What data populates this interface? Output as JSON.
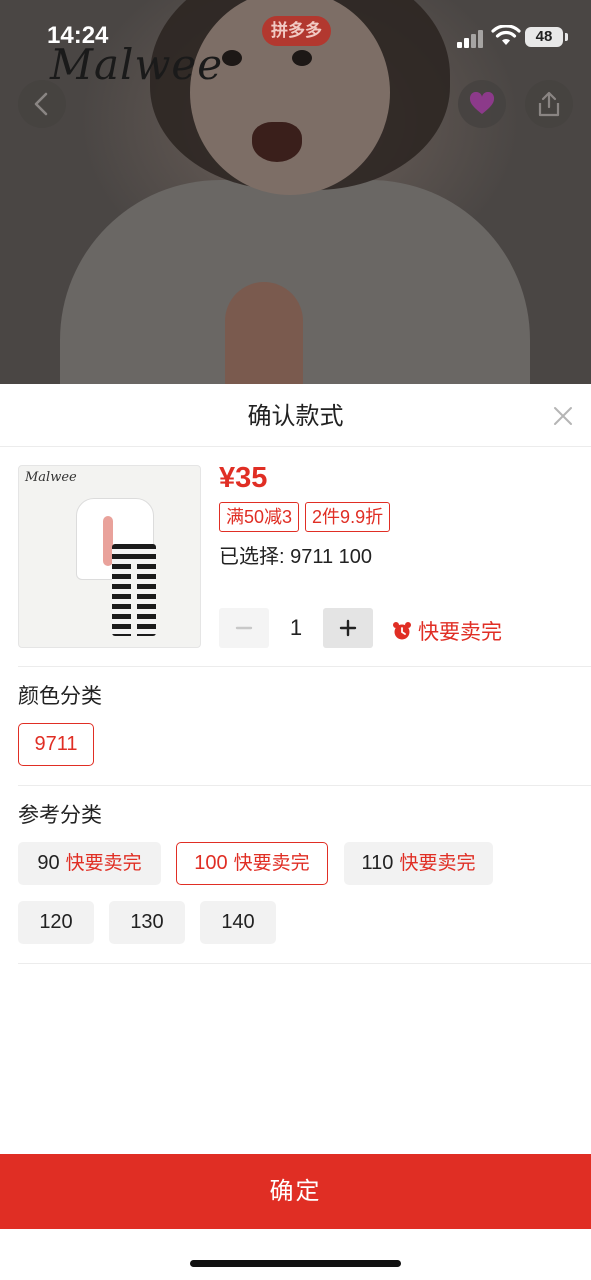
{
  "status_bar": {
    "time": "14:24",
    "battery": "48"
  },
  "hero": {
    "brand_logo": "Malwee",
    "badge": "拼多多"
  },
  "sheet": {
    "title": "确认款式",
    "product": {
      "image_logo": "Malwee",
      "price": "¥35",
      "promo_tags": [
        "满50减3",
        "2件9.9折"
      ],
      "selected_text": "已选择: 9711 100",
      "quantity": "1",
      "stock_hint": "快要卖完"
    },
    "color_section": {
      "label": "颜色分类",
      "options": [
        {
          "label": "9711",
          "selected": true
        }
      ]
    },
    "size_section": {
      "label": "参考分类",
      "options": [
        {
          "label": "90",
          "hint": "快要卖完",
          "selected": false
        },
        {
          "label": "100",
          "hint": "快要卖完",
          "selected": true
        },
        {
          "label": "110",
          "hint": "快要卖完",
          "selected": false
        },
        {
          "label": "120",
          "hint": "",
          "selected": false
        },
        {
          "label": "130",
          "hint": "",
          "selected": false
        },
        {
          "label": "140",
          "hint": "",
          "selected": false
        }
      ]
    },
    "confirm_label": "确定"
  },
  "colors": {
    "accent": "#e02e24",
    "chip_bg": "#f2f2f2"
  },
  "icons": [
    "back-arrow-icon",
    "heart-icon",
    "share-icon",
    "close-icon",
    "minus-icon",
    "plus-icon",
    "alarm-clock-icon"
  ]
}
